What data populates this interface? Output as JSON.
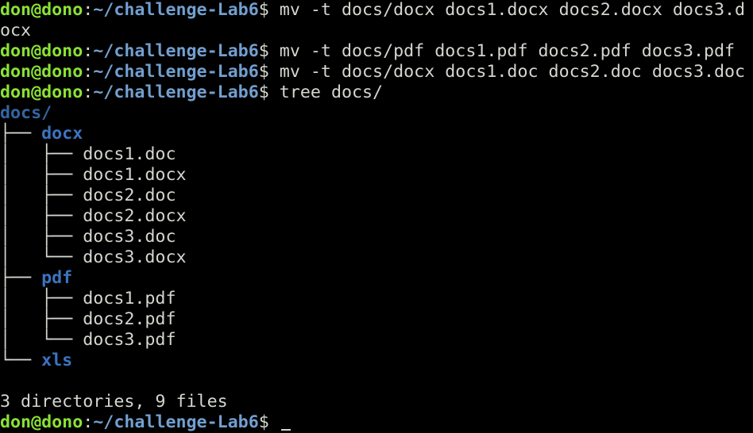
{
  "prompt": {
    "user_host": "don@dono",
    "colon": ":",
    "path": "~/challenge-Lab6",
    "dollar": "$ "
  },
  "commands": [
    {
      "first_line": "mv -t docs/docx docs1.docx docs2.docx docs3.d",
      "continuation": "ocx"
    },
    {
      "first_line": "mv -t docs/pdf docs1.pdf docs2.pdf docs3.pdf"
    },
    {
      "first_line": "mv -t docs/docx docs1.doc docs2.doc docs3.doc"
    },
    {
      "first_line": "tree docs/"
    }
  ],
  "tree": {
    "root": "docs/",
    "folders": [
      {
        "connector": "├── ",
        "name": "docx",
        "files": [
          {
            "connector": "│   ├── ",
            "name": "docs1.doc"
          },
          {
            "connector": "│   ├── ",
            "name": "docs1.docx"
          },
          {
            "connector": "│   ├── ",
            "name": "docs2.doc"
          },
          {
            "connector": "│   ├── ",
            "name": "docs2.docx"
          },
          {
            "connector": "│   ├── ",
            "name": "docs3.doc"
          },
          {
            "connector": "│   └── ",
            "name": "docs3.docx"
          }
        ]
      },
      {
        "connector": "├── ",
        "name": "pdf",
        "files": [
          {
            "connector": "│   ├── ",
            "name": "docs1.pdf"
          },
          {
            "connector": "│   ├── ",
            "name": "docs2.pdf"
          },
          {
            "connector": "│   └── ",
            "name": "docs3.pdf"
          }
        ]
      },
      {
        "connector": "└── ",
        "name": "xls",
        "files": []
      }
    ],
    "summary": "3 directories, 9 files"
  },
  "colors": {
    "background": "#000000",
    "prompt_user": "#8ae234",
    "prompt_path": "#729fcf",
    "directory": "#3465a4",
    "text": "#d3d7cf"
  }
}
